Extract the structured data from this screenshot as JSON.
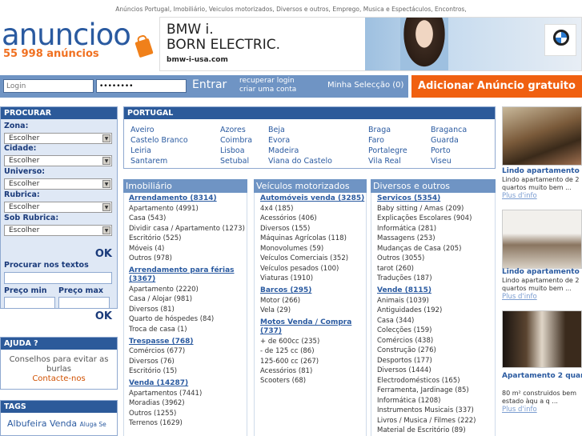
{
  "header": {
    "topline": "Anúncios Portugal, Imobiliário, Veiculos motorizados, Diversos e outros, Emprego, Musica e Espectáculos, Encontros,",
    "logo": "anuncioo",
    "count": "55 998 anúncios"
  },
  "banner": {
    "line1": "BMW i.",
    "line2": "BORN ELECTRIC.",
    "url": "bmw-i-usa.com"
  },
  "login": {
    "login_placeholder": "Login",
    "password_value": "••••••••",
    "entrar": "Entrar",
    "recuperar": "recuperar login",
    "criar": "criar uma conta",
    "minha": "Minha Selecção (0)",
    "adicionar": "Adicionar Anúncio gratuito"
  },
  "search": {
    "title": "PROCURAR",
    "zona": "Zona:",
    "cidade": "Cidade:",
    "universo": "Universo:",
    "rubrica": "Rubrica:",
    "sob_rubrica": "Sob Rubrica:",
    "select_value": "Escolher",
    "ok": "OK",
    "procurar_textos": "Procurar nos textos",
    "preco_min": "Preço min",
    "preco_max": "Preço max"
  },
  "ajuda": {
    "title": "AJUDA ?",
    "text1": "Conselhos para evitar as",
    "text2": "burlas",
    "contacte": "Contacte-nos"
  },
  "tags": {
    "title": "TAGS",
    "t1": "Albufeira",
    "t2": "Venda",
    "t3": "Aluga Se"
  },
  "portugal": {
    "title": "PORTUGAL",
    "locations": [
      "Aveiro",
      "Azores",
      "Beja",
      "Braga",
      "Braganca",
      "Castelo Branco",
      "Coimbra",
      "Evora",
      "Faro",
      "Guarda",
      "Leiria",
      "Lisboa",
      "Madeira",
      "Portalegre",
      "Porto",
      "Santarem",
      "Setubal",
      "Viana do Castelo",
      "Vila Real",
      "Viseu"
    ]
  },
  "columns": {
    "imob": {
      "title": "Imobiliário",
      "s1": "Arrendamento (8314)",
      "s1items": [
        "Apartamento (4991)",
        "Casa (543)",
        "Dividir casa / Apartamento (1273)",
        "Escritório (525)",
        "Móveis (4)",
        "Outros (978)"
      ],
      "s2a": "Arrendamento para férias",
      "s2b": "(3367)",
      "s2items": [
        "Apartamento (2220)",
        "Casa / Alojar (981)",
        "Diversos (81)",
        "Quarto de hóspedes (84)",
        "Troca de casa (1)"
      ],
      "s3": "Trespasse (768)",
      "s3items": [
        "Comércios (677)",
        "Diversos (76)",
        "Escritório (15)"
      ],
      "s4": "Venda (14287)",
      "s4items": [
        "Apartamentos (7441)",
        "Moradias (3962)",
        "Outros (1255)",
        "Terrenos (1629)"
      ]
    },
    "veic": {
      "title": "Veículos motorizados",
      "s1": "Automóveis venda (3285)",
      "s1items": [
        "4x4 (185)",
        "Acessórios (406)",
        "Diversos (155)",
        "Máquinas Agrícolas (118)",
        "Monovolumes (59)",
        "Veículos Comerciais (352)",
        "Veículos pesados (100)",
        "Viaturas (1910)"
      ],
      "s2": "Barcos (295)",
      "s2items": [
        "Motor (266)",
        "Vela (29)"
      ],
      "s3a": "Motos Venda / Compra",
      "s3b": "(737)",
      "s3items": [
        "+ de 600cc (235)",
        "- de 125 cc (86)",
        "125-600 cc (267)",
        "Acessórios (81)",
        "Scooters (68)"
      ]
    },
    "div": {
      "title": "Diversos e outros",
      "s1": "Servicos (5354)",
      "s1items": [
        "Baby sitting / Amas (209)",
        "Explicações Escolares (904)",
        "Informática (281)",
        "Massagens (253)",
        "Mudanças de Casa (205)",
        "Outros (3055)",
        "tarot (260)",
        "Traduções (187)"
      ],
      "s2": "Vende (8115)",
      "s2items": [
        "Animais (1039)",
        "Antiguidades (192)",
        "Casa (344)",
        "Colecções (159)",
        "Comércios (438)",
        "Construção (276)",
        "Desportos (177)",
        "Diversos (1444)",
        "Electrodomésticos (165)",
        "Ferramenta, Jardinage (85)",
        "Informática (1208)",
        "Instrumentos Musicais (337)",
        "Livros / Musica / Filmes (222)",
        "Material de Escritório (89)"
      ]
    }
  },
  "right": {
    "a1": {
      "title": "Lindo apartamento ...",
      "desc": "Lindo apartamento de 2 quartos muito bem ...",
      "link": "Plus d'info"
    },
    "a2": {
      "title": "Lindo apartamento ...",
      "desc": "Lindo apartamento de 2 quartos muito bem ...",
      "link": "Plus d'info"
    },
    "a3": {
      "title": "Apartamento 2 quar ...",
      "desc": "80 m² construidos bem estado àqu a q ...",
      "link": "Plus d'info"
    }
  }
}
